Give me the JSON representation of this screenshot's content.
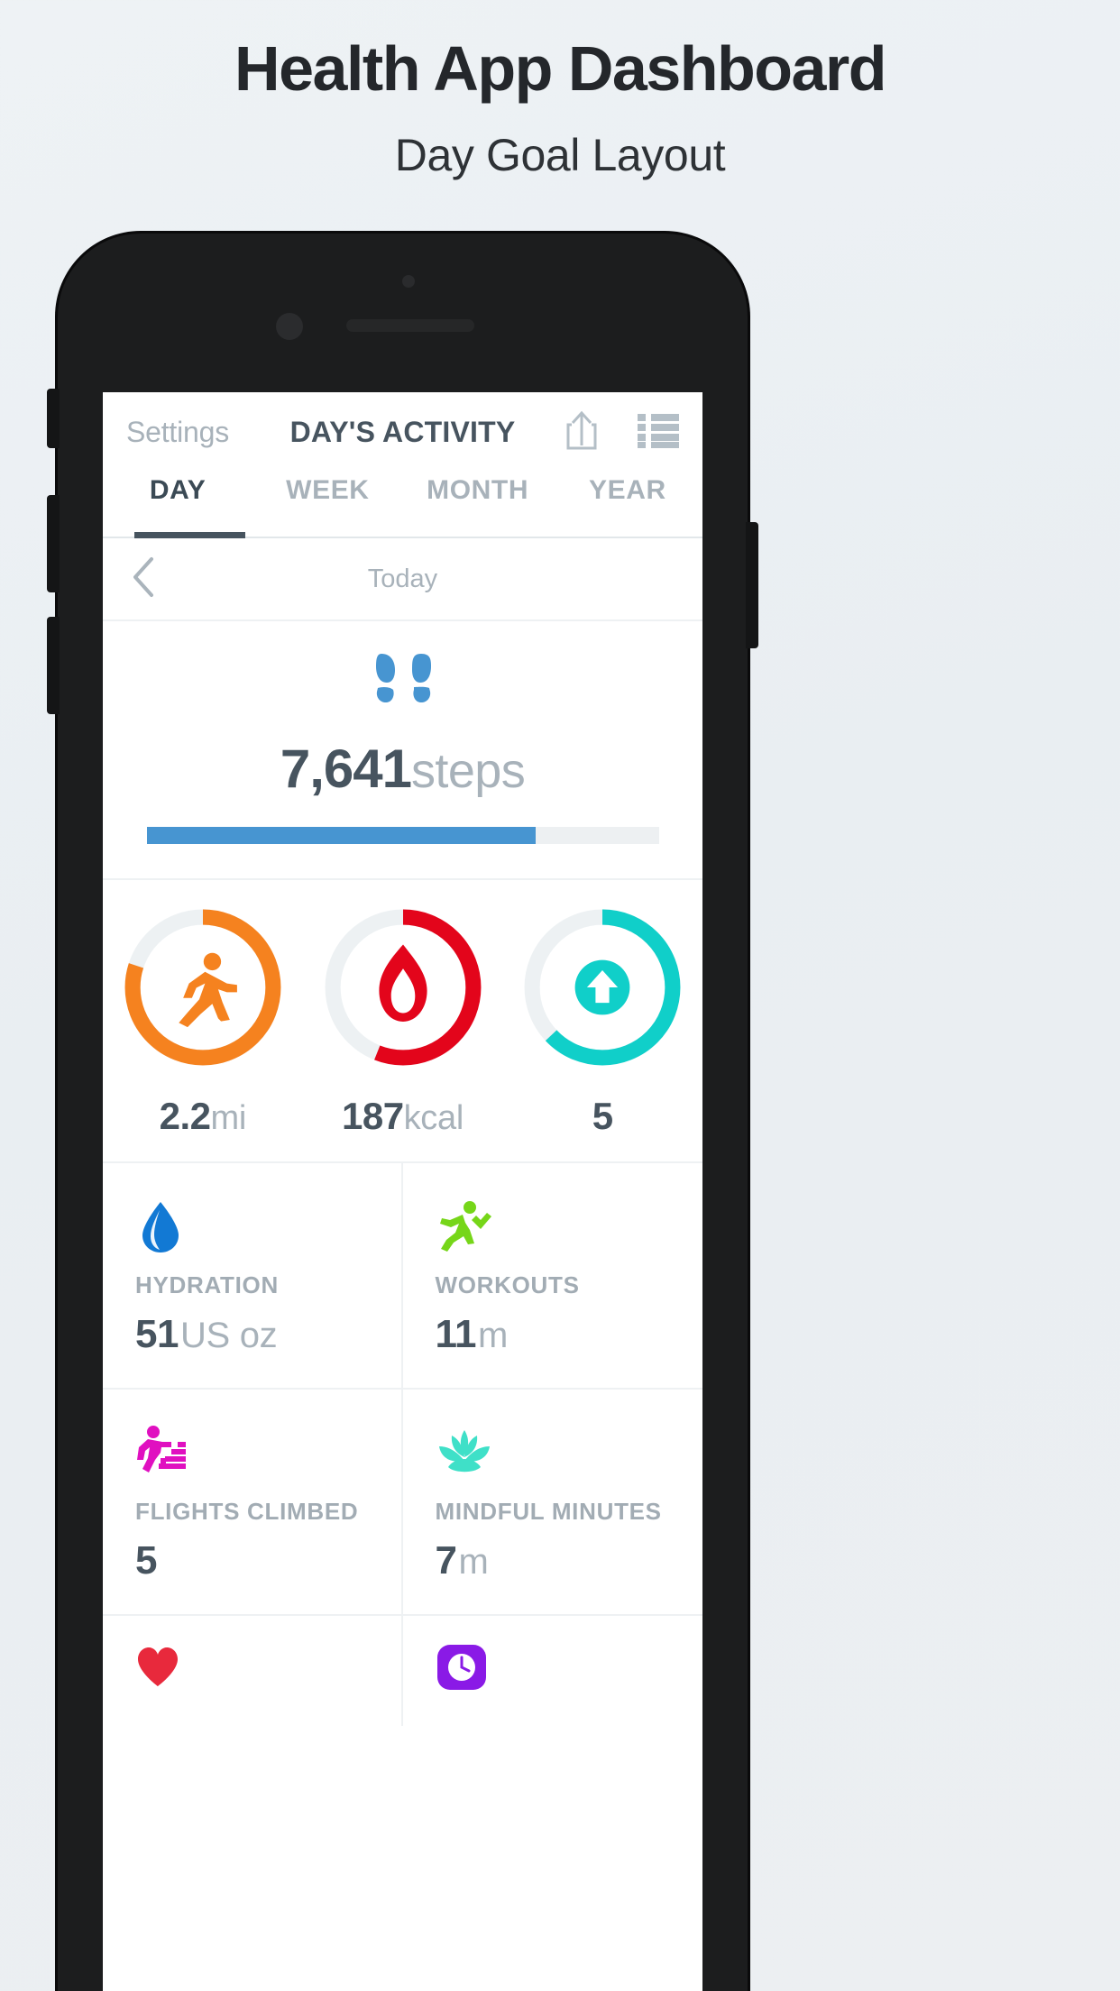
{
  "page": {
    "title": "Health App Dashboard",
    "subtitle": "Day Goal Layout",
    "background": "#eef2f5"
  },
  "app": {
    "navbar": {
      "left_action": "Settings",
      "title": "DAY'S ACTIVITY",
      "share_icon": "share-icon",
      "list_icon": "list-icon"
    },
    "tabs": [
      {
        "label": "DAY",
        "active": true
      },
      {
        "label": "WEEK",
        "active": false
      },
      {
        "label": "MONTH",
        "active": false
      },
      {
        "label": "YEAR",
        "active": false
      }
    ],
    "datebar": {
      "back_icon": "chevron-left-icon",
      "label": "Today"
    },
    "steps": {
      "icon": "footprints-icon",
      "icon_color": "#4795d1",
      "value": "7,641",
      "unit": "steps",
      "progress_percent": 76,
      "progress_color": "#4795d1",
      "track_color": "#edf0f2"
    },
    "rings": [
      {
        "name": "distance",
        "icon": "running-person-icon",
        "color": "#f5821f",
        "percent": 80,
        "value": "2.2",
        "unit": "mi"
      },
      {
        "name": "calories",
        "icon": "flame-icon",
        "color": "#e3051b",
        "percent": 56,
        "value": "187",
        "unit": "kcal"
      },
      {
        "name": "stand-hours",
        "icon": "arrow-up-circle-icon",
        "color": "#10cfc9",
        "percent": 63,
        "value": "5",
        "unit": ""
      }
    ],
    "metrics": [
      {
        "name": "hydration",
        "icon": "water-drop-icon",
        "color": "#1279d4",
        "label": "HYDRATION",
        "value": "51",
        "unit": "US oz"
      },
      {
        "name": "workouts",
        "icon": "workout-runner-icon",
        "color": "#76d619",
        "label": "WORKOUTS",
        "value": "11",
        "unit": "m"
      },
      {
        "name": "flights-climbed",
        "icon": "stairs-climber-icon",
        "color": "#e010c0",
        "label": "FLIGHTS CLIMBED",
        "value": "5",
        "unit": ""
      },
      {
        "name": "mindful-minutes",
        "icon": "lotus-icon",
        "color": "#3fe0c8",
        "label": "MINDFUL MINUTES",
        "value": "7",
        "unit": "m"
      }
    ],
    "partial_row": [
      {
        "name": "heart-rate",
        "icon": "heart-icon",
        "color": "#e8293c"
      },
      {
        "name": "sleep",
        "icon": "sleep-icon",
        "color": "#8a1ae6"
      }
    ]
  }
}
